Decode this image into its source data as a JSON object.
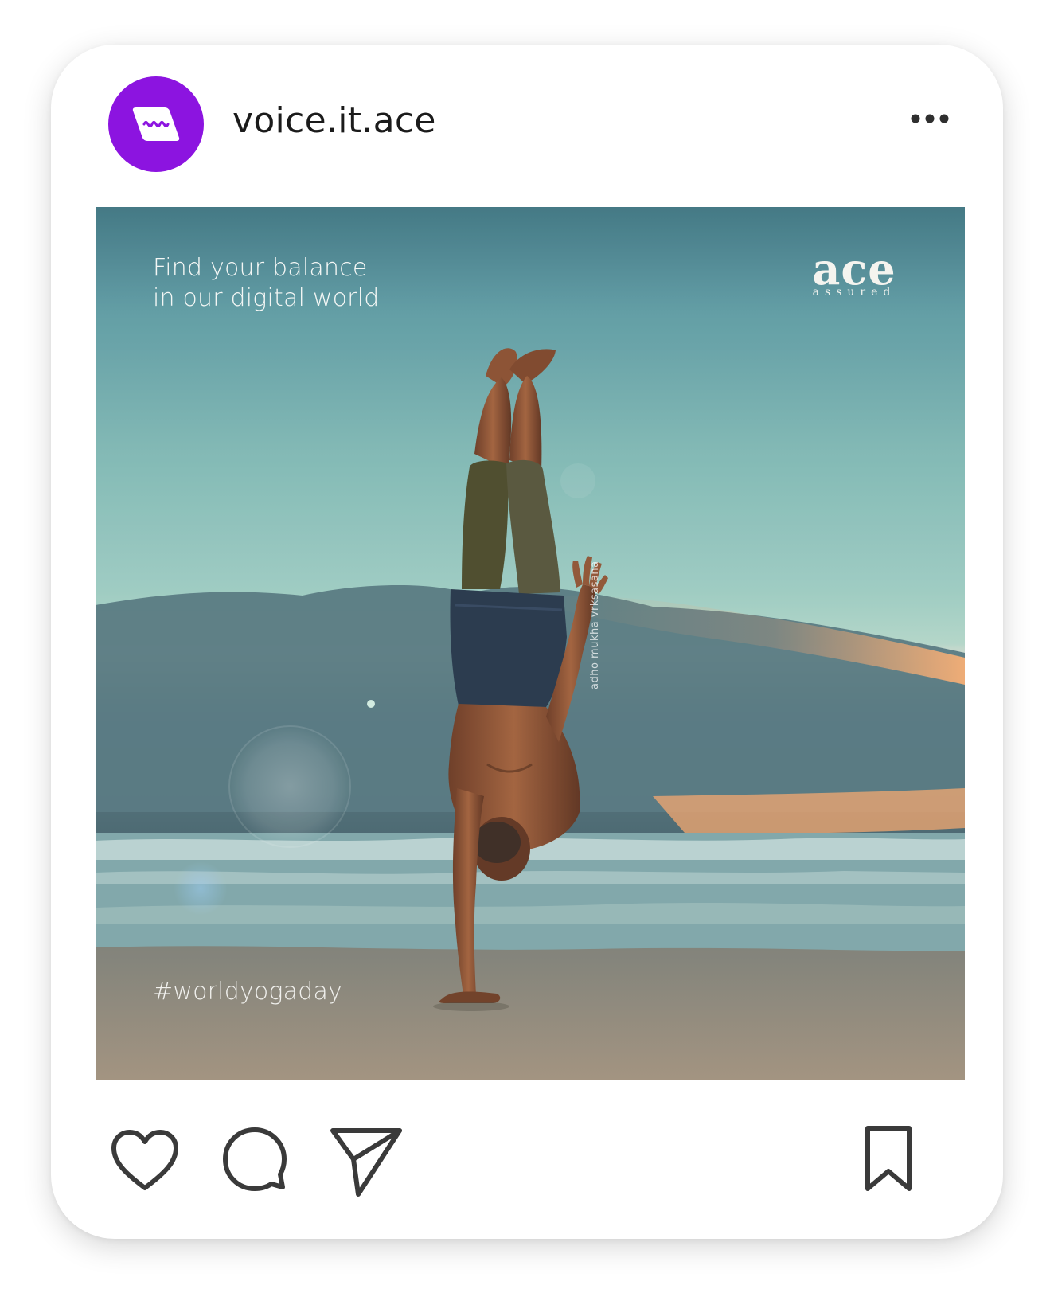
{
  "post": {
    "username": "voice.it.ace",
    "avatar_icon": "brand-wave-logo-icon",
    "more_icon": "more-horizontal-icon",
    "image": {
      "headline_line1": "Find your balance",
      "headline_line2": "in our digital world",
      "brand_name": "ace",
      "brand_tagline": "assured",
      "pose_name": "adho mukha vrksasana",
      "hashtag": "#worldyogaday"
    },
    "actions": {
      "like_icon": "heart-icon",
      "comment_icon": "comment-icon",
      "share_icon": "send-icon",
      "save_icon": "bookmark-icon"
    }
  },
  "colors": {
    "avatar_bg": "#8C14E0",
    "icon_stroke": "#3a3a3a",
    "card_bg": "#ffffff"
  }
}
